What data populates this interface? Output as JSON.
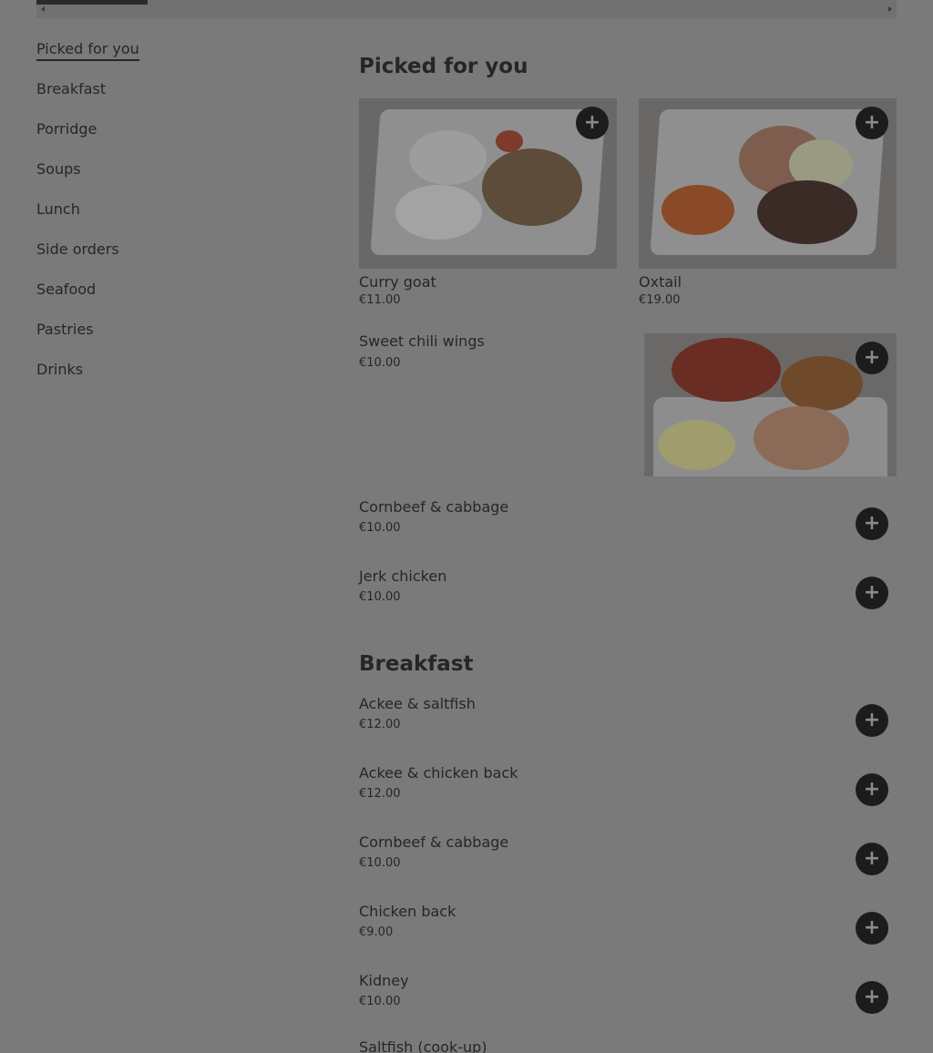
{
  "sidebar": {
    "items": [
      {
        "label": "Picked for you",
        "active": true
      },
      {
        "label": "Breakfast"
      },
      {
        "label": "Porridge"
      },
      {
        "label": "Soups"
      },
      {
        "label": "Lunch"
      },
      {
        "label": "Side orders"
      },
      {
        "label": "Seafood"
      },
      {
        "label": "Pastries"
      },
      {
        "label": "Drinks"
      }
    ]
  },
  "picked": {
    "title": "Picked for you",
    "cards": [
      {
        "name": "Curry goat",
        "price": "€11.00"
      },
      {
        "name": "Oxtail",
        "price": "€19.00"
      }
    ],
    "featured": {
      "name": "Sweet chili wings",
      "price": "€10.00"
    },
    "rows": [
      {
        "name": "Cornbeef & cabbage",
        "price": "€10.00"
      },
      {
        "name": "Jerk chicken",
        "price": "€10.00"
      }
    ]
  },
  "breakfast": {
    "title": "Breakfast",
    "rows": [
      {
        "name": "Ackee & saltfish",
        "price": "€12.00"
      },
      {
        "name": "Ackee & chicken back",
        "price": "€12.00"
      },
      {
        "name": "Cornbeef & cabbage",
        "price": "€10.00"
      },
      {
        "name": "Chicken back",
        "price": "€9.00"
      },
      {
        "name": "Kidney",
        "price": "€10.00"
      },
      {
        "name": "Saltfish (cook-up)",
        "price": ""
      }
    ]
  },
  "icons": {
    "add": "plus-icon"
  },
  "add_symbol": "+"
}
